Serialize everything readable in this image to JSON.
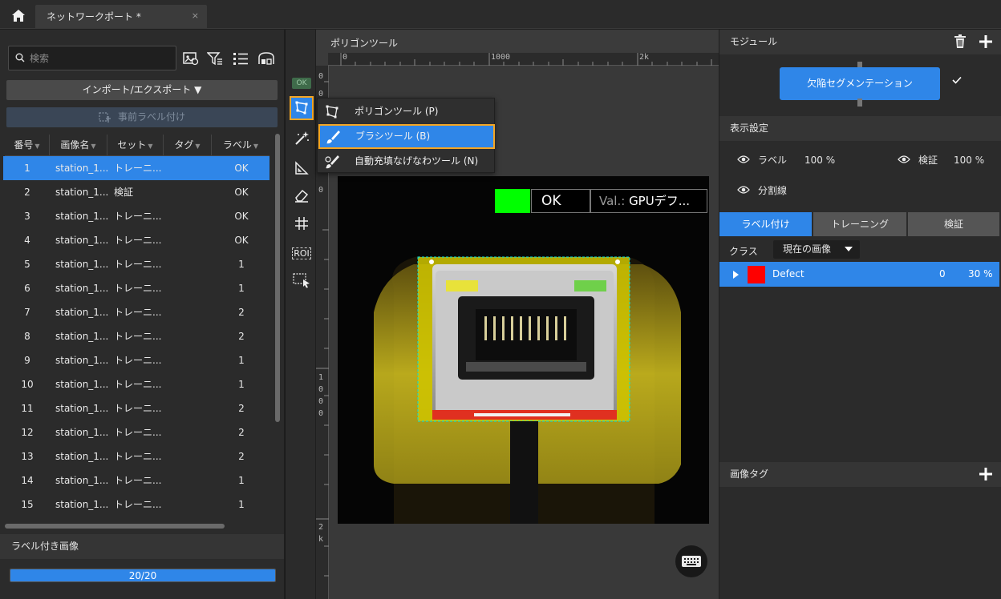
{
  "tabbar": {
    "home_icon": "home-icon",
    "tab_title": "ネットワークポート *",
    "close_glyph": "×"
  },
  "left": {
    "search_placeholder": "検索",
    "import_export_label": "インポート/エクスポート ▼",
    "prelabel_label": "事前ラベル付け",
    "columns": [
      "番号",
      "画像名",
      "セット",
      "タグ",
      "ラベル"
    ],
    "rows": [
      {
        "num": "1",
        "name": "station_1...",
        "set": "トレーニ...",
        "label": "OK",
        "selected": true
      },
      {
        "num": "2",
        "name": "station_1...",
        "set": "検証",
        "label": "OK"
      },
      {
        "num": "3",
        "name": "station_1...",
        "set": "トレーニ...",
        "label": "OK"
      },
      {
        "num": "4",
        "name": "station_1...",
        "set": "トレーニ...",
        "label": "OK"
      },
      {
        "num": "5",
        "name": "station_1...",
        "set": "トレーニ...",
        "label": "1"
      },
      {
        "num": "6",
        "name": "station_1...",
        "set": "トレーニ...",
        "label": "1"
      },
      {
        "num": "7",
        "name": "station_1...",
        "set": "トレーニ...",
        "label": "2"
      },
      {
        "num": "8",
        "name": "station_1...",
        "set": "トレーニ...",
        "label": "2"
      },
      {
        "num": "9",
        "name": "station_1...",
        "set": "トレーニ...",
        "label": "1"
      },
      {
        "num": "10",
        "name": "station_1...",
        "set": "トレーニ...",
        "label": "1"
      },
      {
        "num": "11",
        "name": "station_1...",
        "set": "トレーニ...",
        "label": "2"
      },
      {
        "num": "12",
        "name": "station_1...",
        "set": "トレーニ...",
        "label": "2"
      },
      {
        "num": "13",
        "name": "station_1...",
        "set": "トレーニ...",
        "label": "2"
      },
      {
        "num": "14",
        "name": "station_1...",
        "set": "トレーニ...",
        "label": "1"
      },
      {
        "num": "15",
        "name": "station_1...",
        "set": "トレーニ...",
        "label": "1"
      }
    ],
    "labeled_images_title": "ラベル付き画像",
    "progress_text": "20/20",
    "progress_fraction": 1.0
  },
  "toolstrip": {
    "ok_chip": "OK",
    "roi_label": "ROI"
  },
  "canvas": {
    "title": "ポリゴンツール",
    "ruler_top_labels": [
      "0",
      "1000",
      "2k"
    ],
    "ruler_left_labels": [
      "0",
      "0",
      "0",
      "1",
      "0",
      "0",
      "0",
      "2",
      "k"
    ],
    "result_ok": "OK",
    "result_val_prefix": "Val.:",
    "result_val_text": "GPUデフ...",
    "result_color": "#00ff00"
  },
  "tool_menu": {
    "items": [
      {
        "label": "ポリゴンツール (P)",
        "icon": "polygon-icon"
      },
      {
        "label": "ブラシツール (B)",
        "icon": "brush-icon",
        "selected": true
      },
      {
        "label": "自動充填なげなわツール (N)",
        "icon": "lasso-fill-icon"
      }
    ]
  },
  "right": {
    "module_title": "モジュール",
    "module_name": "欠陥セグメンテーション",
    "display_title": "表示設定",
    "label_vis": "ラベル",
    "label_pct": "100 %",
    "verify_vis": "検証",
    "verify_pct": "100 %",
    "divider_vis": "分割線",
    "tabs": [
      "ラベル付け",
      "トレーニング",
      "検証"
    ],
    "class_label": "クラス",
    "class_select": "現在の画像",
    "class_row": {
      "name": "Defect",
      "count": "0",
      "pct": "30 %",
      "color": "#ff0000"
    },
    "image_tag_title": "画像タグ"
  },
  "colors": {
    "accent": "#2f86e8",
    "highlight": "#f5a623"
  }
}
